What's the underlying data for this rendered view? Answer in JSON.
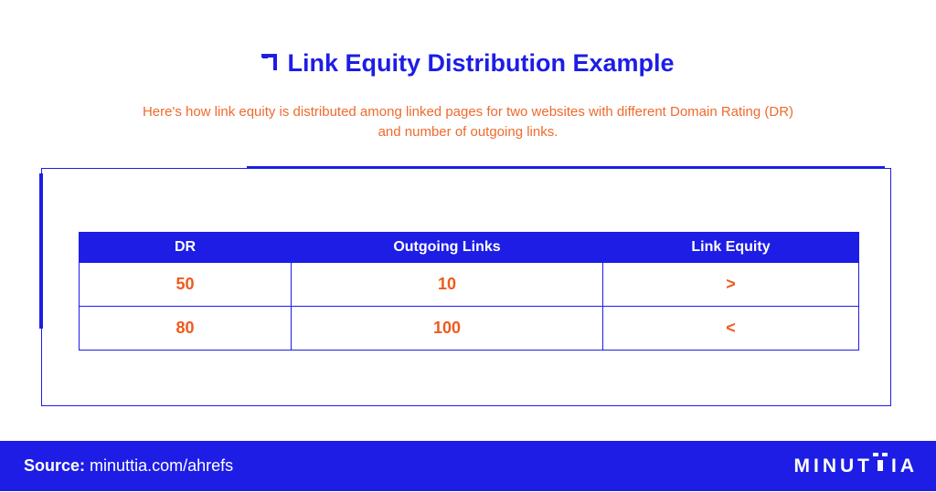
{
  "header": {
    "title": "Link Equity Distribution Example",
    "subtitle": "Here's how link equity is distributed among linked pages for two websites with different Domain Rating (DR) and number of outgoing links."
  },
  "table": {
    "columns": [
      "DR",
      "Outgoing Links",
      "Link Equity"
    ],
    "rows": [
      [
        "50",
        "10",
        ">"
      ],
      [
        "80",
        "100",
        "<"
      ]
    ]
  },
  "footer": {
    "source_label": "Source:",
    "source_url": "minuttia.com/ahrefs",
    "brand_prefix": "MINUT",
    "brand_suffix": "IA"
  },
  "colors": {
    "brand_blue": "#1d1de6",
    "accent_orange": "#ef5a1c",
    "background": "#ffffff"
  },
  "icons": {
    "title_marker": "corner-bracket-icon",
    "brand_mark": "logo-t-mark-icon"
  }
}
